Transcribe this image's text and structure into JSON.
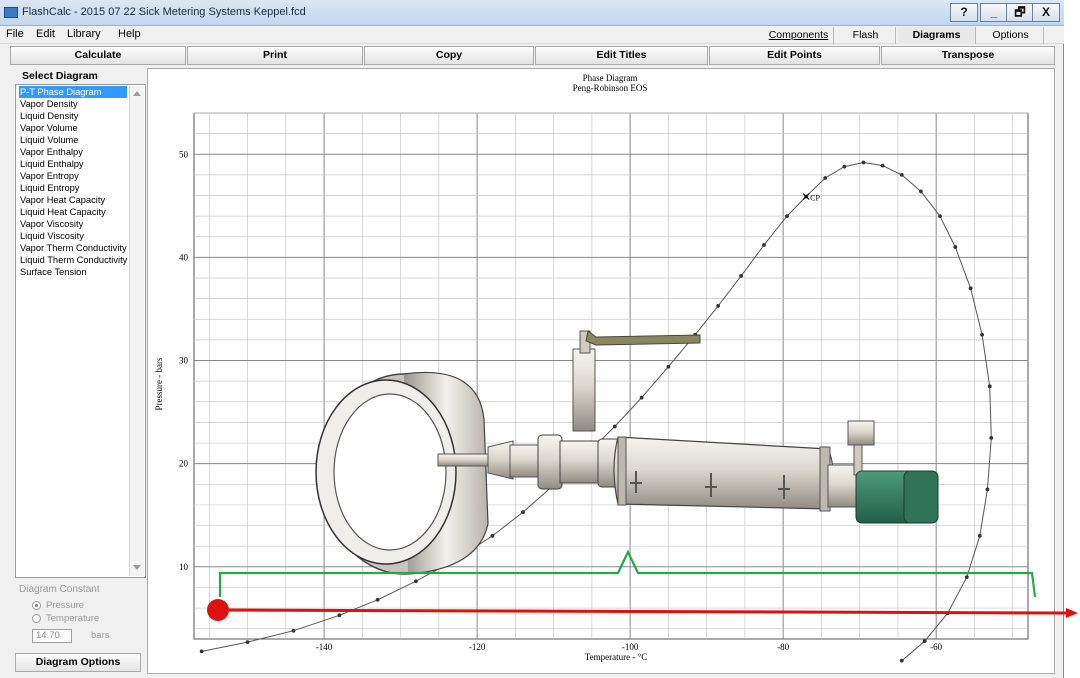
{
  "window": {
    "title": "FlashCalc - 2015 07 22 Sick Metering Systems Keppel.fcd",
    "buttons": [
      "?",
      "_",
      "🗗",
      "X"
    ]
  },
  "menu": {
    "items": [
      "File",
      "Edit",
      "Library",
      "Help"
    ],
    "tabs": [
      "Components",
      "Flash",
      "Diagrams",
      "Options"
    ],
    "active_tab": "Diagrams"
  },
  "toolbar": {
    "buttons": [
      "Calculate",
      "Print",
      "Copy",
      "Edit Titles",
      "Edit Points",
      "Transpose"
    ]
  },
  "select_diagram": {
    "header": "Select Diagram",
    "items": [
      "P-T Phase Diagram",
      "Vapor Density",
      "Liquid Density",
      "Vapor Volume",
      "Liquid Volume",
      "Vapor Enthalpy",
      "Liquid Enthalpy",
      "Vapor Entropy",
      "Liquid Entropy",
      "Vapor Heat Capacity",
      "Liquid Heat Capacity",
      "Vapor Viscosity",
      "Liquid Viscosity",
      "Vapor Therm Conductivity",
      "Liquid Therm Conductivity",
      "Surface Tension"
    ],
    "selected_index": 0
  },
  "diagram_constant": {
    "header": "Diagram Constant",
    "options": [
      "Pressure",
      "Temperature"
    ],
    "selected": "Pressure",
    "value": "14.70",
    "unit": "bars"
  },
  "diagram_options_label": "Diagram Options",
  "chart_data": {
    "type": "line",
    "title": "Phase Diagram",
    "subtitle": "Peng-Robinson EOS",
    "xlabel": "Temperature - °C",
    "ylabel": "Pressure - bars",
    "xlim": [
      -157,
      -48
    ],
    "ylim": [
      3,
      54
    ],
    "xticks": [
      -140,
      -120,
      -100,
      -80,
      -60
    ],
    "yticks": [
      10,
      20,
      30,
      40,
      50
    ],
    "grid": true,
    "critical_point": {
      "label": "CP",
      "x": -77,
      "y": 45.9
    },
    "series": [
      {
        "values": [
          [
            -156,
            1.8
          ],
          [
            -150,
            2.7
          ],
          [
            -144,
            3.8
          ],
          [
            -138,
            5.3
          ],
          [
            -133,
            6.8
          ],
          [
            -128,
            8.6
          ],
          [
            -123,
            10.6
          ],
          [
            -118,
            13.0
          ],
          [
            -114,
            15.3
          ],
          [
            -110,
            17.9
          ],
          [
            -106,
            20.7
          ],
          [
            -102,
            23.6
          ],
          [
            -98.5,
            26.4
          ],
          [
            -95,
            29.4
          ],
          [
            -91.5,
            32.5
          ],
          [
            -88.5,
            35.3
          ],
          [
            -85.5,
            38.2
          ],
          [
            -82.5,
            41.2
          ],
          [
            -79.5,
            44.0
          ],
          [
            -77,
            45.9
          ],
          [
            -74.5,
            47.7
          ],
          [
            -72,
            48.8
          ],
          [
            -69.5,
            49.2
          ],
          [
            -67,
            48.9
          ],
          [
            -64.5,
            48.0
          ],
          [
            -62,
            46.4
          ],
          [
            -59.5,
            44.0
          ],
          [
            -57.5,
            41.0
          ],
          [
            -55.5,
            37.0
          ],
          [
            -54,
            32.5
          ],
          [
            -53,
            27.5
          ],
          [
            -52.8,
            22.5
          ],
          [
            -53.3,
            17.5
          ],
          [
            -54.3,
            13.0
          ],
          [
            -56,
            9.0
          ],
          [
            -58.5,
            5.5
          ],
          [
            -61.5,
            2.8
          ],
          [
            -64.5,
            0.9
          ]
        ]
      }
    ]
  }
}
